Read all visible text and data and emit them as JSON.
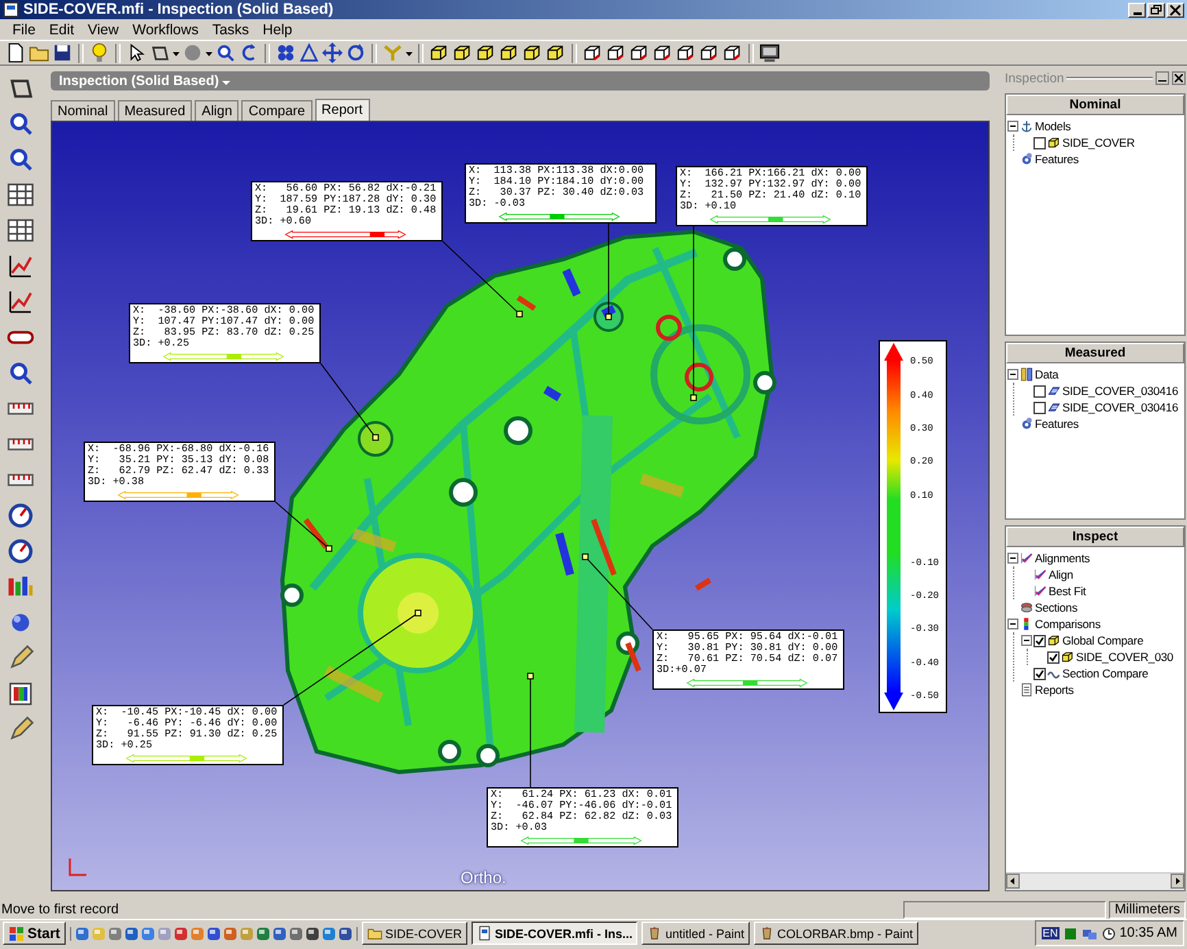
{
  "window": {
    "title": "SIDE-COVER.mfi - Inspection (Solid Based)"
  },
  "menu": [
    "File",
    "Edit",
    "View",
    "Workflows",
    "Tasks",
    "Help"
  ],
  "document": {
    "title": "Inspection (Solid Based)",
    "tabs": [
      {
        "label": "Nominal",
        "selected": false
      },
      {
        "label": "Measured",
        "selected": false
      },
      {
        "label": "Align",
        "selected": false
      },
      {
        "label": "Compare",
        "selected": false
      },
      {
        "label": "Report",
        "selected": true
      }
    ]
  },
  "viewport": {
    "projection": "Ortho.",
    "callouts": [
      {
        "lines": [
          "X:   56.60 PX: 56.82 dX:-0.21",
          "Y:  187.59 PY:187.28 dY: 0.30",
          "Z:   19.61 PZ: 19.13 dZ: 0.48",
          "3D: +0.60"
        ],
        "color": "#ff0000",
        "level": 0.8
      },
      {
        "lines": [
          "X:  113.38 PX:113.38 dX:0.00",
          "Y:  184.10 PY:184.10 dY:0.00",
          "Z:   30.37 PZ: 30.40 dZ:0.03",
          "3D: -0.03"
        ],
        "color": "#00cc00",
        "level": 0.48
      },
      {
        "lines": [
          "X:  166.21 PX:166.21 dX: 0.00",
          "Y:  132.97 PY:132.97 dY: 0.00",
          "Z:   21.50 PZ: 21.40 dZ: 0.10",
          "3D: +0.10"
        ],
        "color": "#33dd33",
        "level": 0.55
      },
      {
        "lines": [
          "X:  -38.60 PX:-38.60 dX: 0.00",
          "Y:  107.47 PY:107.47 dY: 0.00",
          "Z:   83.95 PZ: 83.70 dZ: 0.25",
          "3D: +0.25"
        ],
        "color": "#aaee00",
        "level": 0.6
      },
      {
        "lines": [
          "X:  -68.96 PX:-68.80 dX:-0.16",
          "Y:   35.21 PY: 35.13 dY: 0.08",
          "Z:   62.79 PZ: 62.47 dZ: 0.33",
          "3D: +0.38"
        ],
        "color": "#ffb000",
        "level": 0.65
      },
      {
        "lines": [
          "X:   95.65 PX: 95.64 dX:-0.01",
          "Y:   30.81 PY: 30.81 dY: 0.00",
          "Z:   70.61 PZ: 70.54 dZ: 0.07",
          "3D:+0.07"
        ],
        "color": "#33dd33",
        "level": 0.53
      },
      {
        "lines": [
          "X:  -10.45 PX:-10.45 dX: 0.00",
          "Y:   -6.46 PY: -6.46 dY: 0.00",
          "Z:   91.55 PZ: 91.30 dZ: 0.25",
          "3D: +0.25"
        ],
        "color": "#aaee00",
        "level": 0.6
      },
      {
        "lines": [
          "X:   61.24 PX: 61.23 dX: 0.01",
          "Y:  -46.07 PY:-46.06 dY:-0.01",
          "Z:   62.84 PZ: 62.82 dZ: 0.03",
          "3D: +0.03"
        ],
        "color": "#33dd33",
        "level": 0.5
      }
    ],
    "color_scale": {
      "labels": [
        "0.50",
        "0.40",
        "0.30",
        "0.20",
        "0.10",
        "-0.10",
        "-0.20",
        "-0.30",
        "-0.40",
        "-0.50"
      ]
    }
  },
  "inspection_panel": {
    "title": "Inspection",
    "sections": [
      {
        "title": "Nominal",
        "items": [
          {
            "label": "Models",
            "kind": "models",
            "expanded": true,
            "children": [
              {
                "label": "SIDE_COVER",
                "kind": "part",
                "checked": false
              }
            ]
          },
          {
            "label": "Features",
            "kind": "features"
          }
        ]
      },
      {
        "title": "Measured",
        "items": [
          {
            "label": "Data",
            "kind": "data",
            "expanded": true,
            "children": [
              {
                "label": "SIDE_COVER_030416",
                "kind": "scan",
                "checked": false
              },
              {
                "label": "SIDE_COVER_030416",
                "kind": "scan",
                "checked": false
              }
            ]
          },
          {
            "label": "Features",
            "kind": "features"
          }
        ]
      },
      {
        "title": "Inspect",
        "items": [
          {
            "label": "Alignments",
            "kind": "alignments",
            "expanded": true,
            "children": [
              {
                "label": "Align",
                "kind": "alignment"
              },
              {
                "label": "Best Fit",
                "kind": "alignment"
              }
            ]
          },
          {
            "label": "Sections",
            "kind": "sections"
          },
          {
            "label": "Comparisons",
            "kind": "comparisons",
            "expanded": true,
            "children": [
              {
                "label": "Global Compare",
                "kind": "compare",
                "checked": true,
                "expanded": true,
                "children": [
                  {
                    "label": "SIDE_COVER_030",
                    "kind": "compare",
                    "checked": true
                  }
                ]
              },
              {
                "label": "Section Compare",
                "kind": "section-compare",
                "checked": true
              }
            ]
          },
          {
            "label": "Reports",
            "kind": "reports"
          }
        ]
      }
    ]
  },
  "status_bar": {
    "message": "Move to first record",
    "units": "Millimeters"
  },
  "taskbar": {
    "start": "Start",
    "tasks": [
      {
        "label": "SIDE-COVER",
        "selected": false
      },
      {
        "label": "SIDE-COVER.mfi - Ins...",
        "selected": true
      },
      {
        "label": "untitled - Paint",
        "selected": false
      },
      {
        "label": "COLORBAR.bmp - Paint",
        "selected": false
      }
    ],
    "language": "EN",
    "clock": "10:35 AM"
  }
}
